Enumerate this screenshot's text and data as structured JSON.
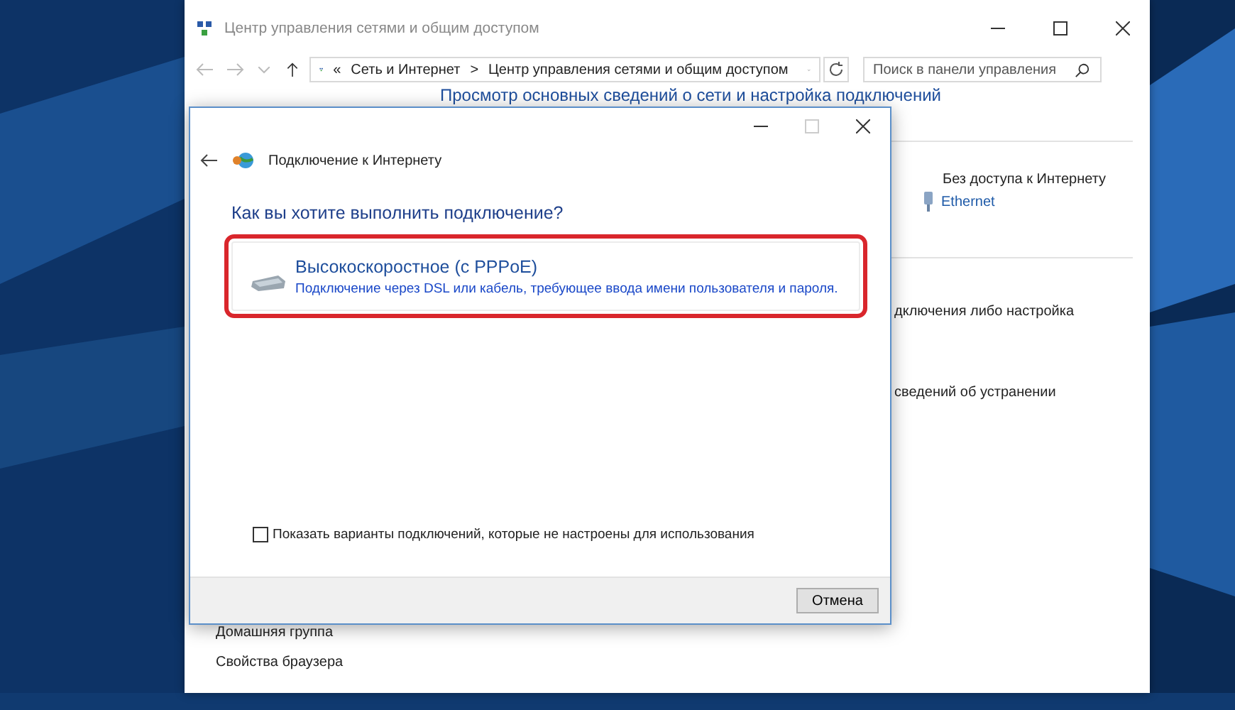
{
  "window": {
    "title": "Центр управления сетями и общим доступом"
  },
  "address_bar": {
    "prefix": "«",
    "breadcrumbs": [
      "Сеть и Интернет",
      "Центр управления сетями и общим доступом"
    ],
    "separator": ">"
  },
  "search": {
    "placeholder": "Поиск в панели управления"
  },
  "heading": "Просмотр основных сведений о сети и настройка подключений",
  "network": {
    "status": "Без доступа к Интернету",
    "connection": "Ethernet"
  },
  "fragments": [
    "дключения либо настройка",
    "сведений об устранении"
  ],
  "sidebar_links": [
    "Домашняя группа",
    "Свойства браузера"
  ],
  "dialog": {
    "title": "Подключение к Интернету",
    "question": "Как вы хотите выполнить подключение?",
    "options": [
      {
        "title": "Высокоскоростное (с PPPoE)",
        "description": "Подключение через DSL или кабель, требующее ввода имени пользователя и пароля.",
        "selected": true
      }
    ],
    "checkbox": {
      "label": "Показать варианты подключений, которые не настроены для использования",
      "checked": false
    },
    "buttons": [
      "Отмена"
    ]
  }
}
